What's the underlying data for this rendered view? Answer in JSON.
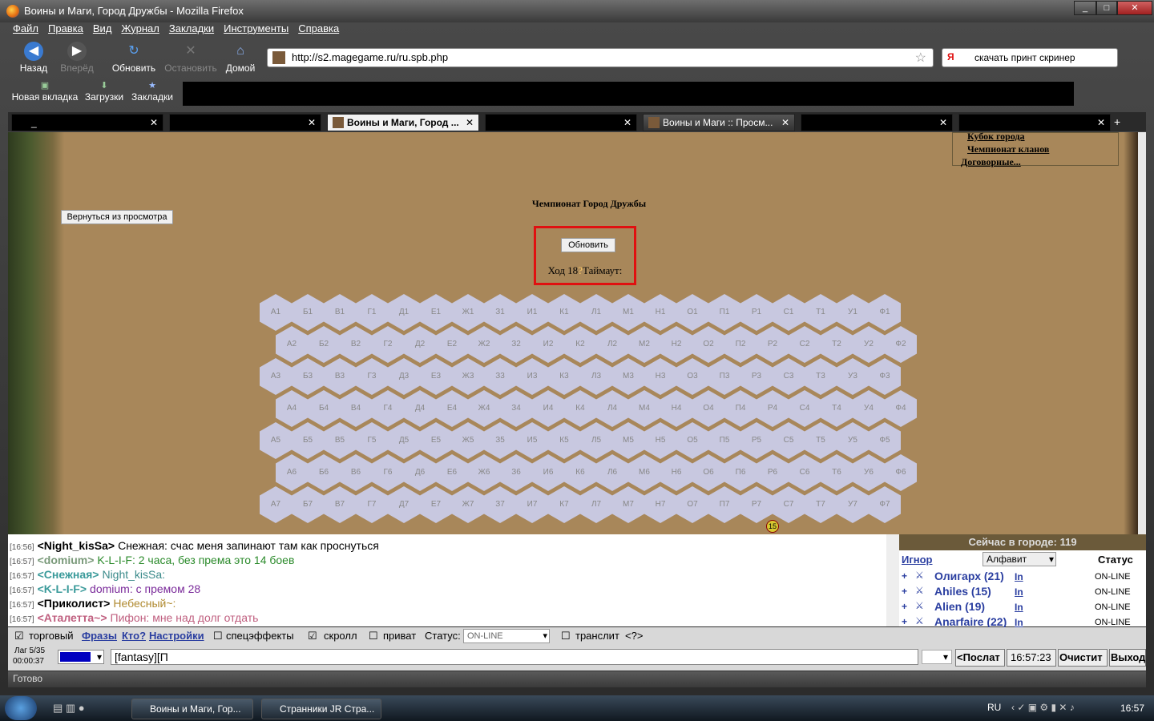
{
  "window": {
    "title": "Воины и Маги, Город Дружбы - Mozilla Firefox",
    "min": "_",
    "max": "□",
    "close": "✕"
  },
  "menu": [
    "Файл",
    "Правка",
    "Вид",
    "Журнал",
    "Закладки",
    "Инструменты",
    "Справка"
  ],
  "nav": {
    "back": "Назад",
    "forward": "Вперёд",
    "reload": "Обновить",
    "stop": "Остановить",
    "home": "Домой"
  },
  "url": "http://s2.magegame.ru/ru.spb.php",
  "search": {
    "engine": "Я",
    "text": "скачать принт скринер"
  },
  "bookmarks": {
    "newtab": "Новая вкладка",
    "downloads": "Загрузки",
    "bookmarks": "Закладки"
  },
  "tabs": [
    {
      "label": "_",
      "selected": false,
      "masked": true
    },
    {
      "label": "",
      "selected": false,
      "masked": true
    },
    {
      "label": "Воины и Маги, Город ...",
      "selected": true,
      "masked": false
    },
    {
      "label": "",
      "selected": false,
      "masked": true
    },
    {
      "label": "Воины и Маги :: Просм...",
      "selected": false,
      "masked": false
    },
    {
      "label": "",
      "selected": false,
      "masked": true
    },
    {
      "label": "",
      "selected": false,
      "masked": true
    }
  ],
  "side_menu": [
    "Кубок города",
    "Чемпионат кланов",
    "Договорные..."
  ],
  "page": {
    "title": "Чемпионат Город Дружбы",
    "back_button": "Вернуться из просмотра",
    "refresh_button": "Обновить",
    "turn": "Ход 18",
    "timeout": "Таймаут:"
  },
  "board": {
    "columns": [
      "А",
      "Б",
      "В",
      "Г",
      "Д",
      "Е",
      "Ж",
      "З",
      "И",
      "К",
      "Л",
      "М",
      "Н",
      "О",
      "П",
      "Р",
      "С",
      "Т",
      "У",
      "Ф"
    ],
    "rows": [
      1,
      2,
      3,
      4,
      5,
      6,
      7
    ],
    "unit_label": "15"
  },
  "chat": [
    {
      "time": "[16:56]",
      "nick": "<Night_kisSa>",
      "text": "Снежная: счас меня запинают там как проснуться",
      "nickColor": "#000",
      "textColor": "#000"
    },
    {
      "time": "[16:57]",
      "nick": "<domium>",
      "text": "K-L-I-F: 2 часа, без према это 14 боев",
      "nickColor": "#7a9a7a",
      "textColor": "#2a8a2a"
    },
    {
      "time": "[16:57]",
      "nick": "<Снежная>",
      "text": "Night_kisSa:",
      "nickColor": "#3a9a9a",
      "textColor": "#3a8a8a"
    },
    {
      "time": "[16:57]",
      "nick": "<K-L-I-F>",
      "text": "domium: с премом 28",
      "nickColor": "#3a9a9a",
      "textColor": "#7a2a9a"
    },
    {
      "time": "[16:57]",
      "nick": "<Приколист>",
      "text": "Небесный~:",
      "nickColor": "#000",
      "textColor": "#b08a30"
    },
    {
      "time": "[16:57]",
      "nick": "<Аталетта~>",
      "text": "Пифон: мне над долг отдать",
      "nickColor": "#c06080",
      "textColor": "#c06080"
    }
  ],
  "online": {
    "header": "Сейчас в городе: 119",
    "ignore": "Игнор",
    "sort": "Алфавит",
    "status_label": "Статус",
    "users": [
      {
        "name": "Олигарх (21)",
        "status": "ON-LINE"
      },
      {
        "name": "Ahiles (15)",
        "status": "ON-LINE"
      },
      {
        "name": "Alien (19)",
        "status": "ON-LINE"
      },
      {
        "name": "Anarfaire (22)",
        "status": "ON-LINE"
      }
    ],
    "in": "In"
  },
  "options": {
    "trade": "торговый",
    "phrases": "Фразы",
    "who": "Кто?",
    "settings": "Настройки",
    "effects": "спецэффекты",
    "scroll": "скролл",
    "private": "приват",
    "status": "Статус:",
    "status_value": "ON-LINE",
    "translit": "транслит",
    "help": "<?>"
  },
  "input": {
    "lag": "Лаг 5/35",
    "timer": "00:00:37",
    "prefix": "[fantasy][П",
    "send": "<Послат",
    "time": "16:57:23",
    "clear": "Очистит",
    "exit": "Выход"
  },
  "statusbar": "Готово",
  "taskbar": {
    "task1": "Воины и Маги, Гор...",
    "task2": "Странники JR Стра...",
    "lang": "RU",
    "clock": "16:57"
  },
  "colors": {
    "page_bg": "#a8875a",
    "hex": "#c8c8e0",
    "highlight": "#e01010"
  }
}
